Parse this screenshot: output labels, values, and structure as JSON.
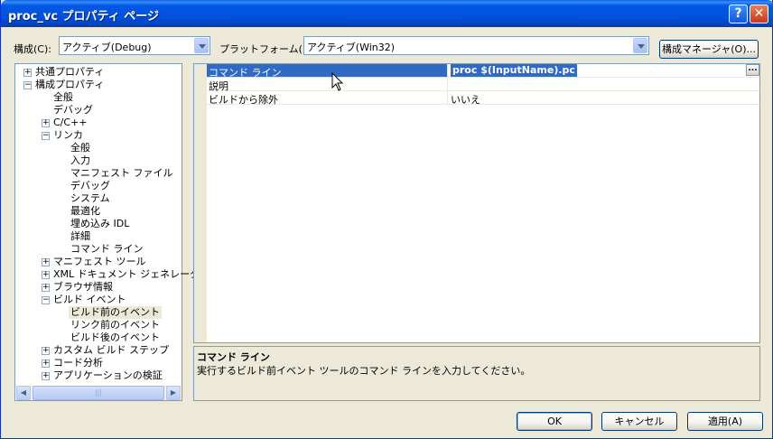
{
  "window": {
    "title": "proc_vc プロパティ ページ",
    "help_label": "?",
    "close_label": "✕"
  },
  "config": {
    "label": "構成(C):",
    "value": "アクティブ(Debug)"
  },
  "platform": {
    "label": "プラットフォーム(P):",
    "value": "アクティブ(Win32)"
  },
  "config_manager_label": "構成マネージャ(O)...",
  "tree": {
    "items": [
      {
        "label": "共通プロパティ",
        "expander": "+"
      },
      {
        "label": "構成プロパティ",
        "expander": "−"
      },
      {
        "label": "全般"
      },
      {
        "label": "デバッグ"
      },
      {
        "label": "C/C++",
        "expander": "+"
      },
      {
        "label": "リンカ",
        "expander": "−"
      },
      {
        "label": "全般"
      },
      {
        "label": "入力"
      },
      {
        "label": "マニフェスト ファイル"
      },
      {
        "label": "デバッグ"
      },
      {
        "label": "システム"
      },
      {
        "label": "最適化"
      },
      {
        "label": "埋め込み IDL"
      },
      {
        "label": "詳細"
      },
      {
        "label": "コマンド ライン"
      },
      {
        "label": "マニフェスト ツール",
        "expander": "+"
      },
      {
        "label": "XML ドキュメント ジェネレータ",
        "expander": "+"
      },
      {
        "label": "ブラウザ情報",
        "expander": "+"
      },
      {
        "label": "ビルド イベント",
        "expander": "−"
      },
      {
        "label": "ビルド前のイベント",
        "selected": true
      },
      {
        "label": "リンク前のイベント"
      },
      {
        "label": "ビルド後のイベント"
      },
      {
        "label": "カスタム ビルド ステップ",
        "expander": "+"
      },
      {
        "label": "コード分析",
        "expander": "+"
      },
      {
        "label": "アプリケーションの検証",
        "expander": "+"
      }
    ]
  },
  "grid": {
    "rows": [
      {
        "name": "コマンド ライン",
        "value": "proc $(InputName).pc",
        "selected": true
      },
      {
        "name": "説明",
        "value": ""
      },
      {
        "name": "ビルドから除外",
        "value": "いいえ"
      }
    ],
    "ellipsis_label": "..."
  },
  "description": {
    "title": "コマンド ライン",
    "text": "実行するビルド前イベント ツールのコマンド ラインを入力してください。"
  },
  "buttons": {
    "ok": "OK",
    "cancel": "キャンセル",
    "apply": "適用(A)"
  },
  "colors": {
    "titlebar": "#0054e3",
    "selection": "#316ac5",
    "dialog_bg": "#ece9d8"
  }
}
